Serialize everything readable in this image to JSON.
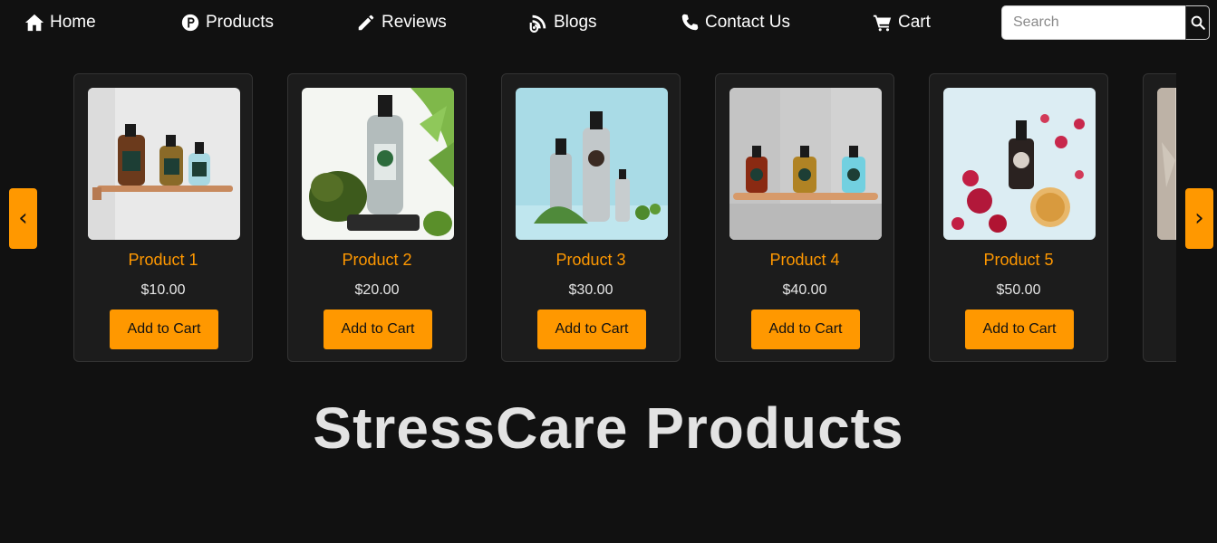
{
  "nav": {
    "items": [
      {
        "label": "Home",
        "icon": "home-icon"
      },
      {
        "label": "Products",
        "icon": "product-hunt-icon"
      },
      {
        "label": "Reviews",
        "icon": "pencil-icon"
      },
      {
        "label": "Blogs",
        "icon": "blog-icon"
      },
      {
        "label": "Contact Us",
        "icon": "phone-icon"
      },
      {
        "label": "Cart",
        "icon": "cart-icon"
      }
    ],
    "search": {
      "placeholder": "Search",
      "value": "",
      "icon": "search-icon"
    }
  },
  "carousel": {
    "prev_label": "‹",
    "next_label": "›",
    "products": [
      {
        "name": "Product 1",
        "price": "$10.00",
        "button": "Add to Cart",
        "image": "amber-bottles-on-copper-shelf"
      },
      {
        "name": "Product 2",
        "price": "$20.00",
        "button": "Add to Cart",
        "image": "silver-bottle-with-moss"
      },
      {
        "name": "Product 3",
        "price": "$30.00",
        "button": "Add to Cart",
        "image": "silver-bottles-with-herbs"
      },
      {
        "name": "Product 4",
        "price": "$40.00",
        "button": "Add to Cart",
        "image": "colored-bottles-on-shelf"
      },
      {
        "name": "Product 5",
        "price": "$50.00",
        "button": "Add to Cart",
        "image": "serum-dropper-with-roses"
      }
    ]
  },
  "heading": "StressCare Products",
  "colors": {
    "accent": "#ff9800",
    "background": "#111111",
    "card": "#1c1c1c",
    "heading": "#e3e3e3"
  }
}
